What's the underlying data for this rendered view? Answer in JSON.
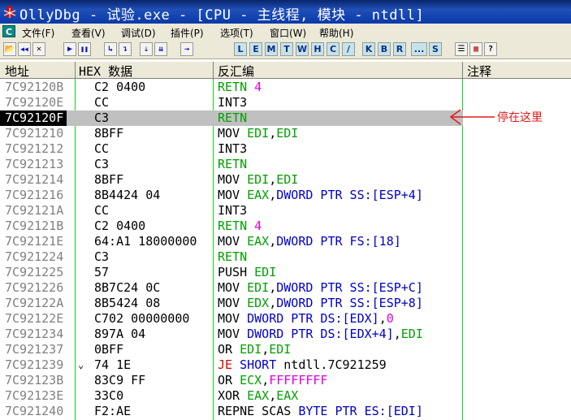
{
  "window": {
    "title": "OllyDbg - 试验.exe - [CPU - 主线程, 模块 - ntdll]"
  },
  "menu": [
    {
      "label": "文件(F)"
    },
    {
      "label": "查看(V)"
    },
    {
      "label": "调试(D)"
    },
    {
      "label": "插件(P)"
    },
    {
      "label": "选项(T)"
    },
    {
      "label": "窗口(W)"
    },
    {
      "label": "帮助(H)"
    }
  ],
  "menu_icon": "C",
  "toolbar": {
    "buttons": [
      {
        "name": "open-icon",
        "glyph": "📂"
      },
      {
        "name": "rewind-icon",
        "glyph": "◀◀"
      },
      {
        "name": "close-icon",
        "glyph": "✕"
      },
      {
        "name": "run-icon",
        "glyph": "▶"
      },
      {
        "name": "pause-icon",
        "glyph": "❚❚"
      },
      {
        "name": "step-into-icon",
        "glyph": "↳"
      },
      {
        "name": "step-over-icon",
        "glyph": "↴"
      },
      {
        "name": "trace-into-icon",
        "glyph": "⇣"
      },
      {
        "name": "trace-over-icon",
        "glyph": "⇊"
      },
      {
        "name": "execute-till-return-icon",
        "glyph": "→"
      }
    ],
    "letters": [
      "L",
      "E",
      "M",
      "T",
      "W",
      "H",
      "C",
      "/",
      "K",
      "B",
      "R",
      "...",
      "S"
    ],
    "right_buttons": [
      {
        "name": "list-icon",
        "glyph": "☰"
      },
      {
        "name": "grid-icon",
        "glyph": "▦"
      },
      {
        "name": "help-icon",
        "glyph": "?"
      }
    ]
  },
  "columns": {
    "address": "地址",
    "hex": "HEX 数据",
    "disasm": "反汇编",
    "comment": "注释"
  },
  "rows": [
    {
      "addr": "7C92120B",
      "hex": "C2 0400",
      "jm": "",
      "dis": [
        [
          "g",
          "RETN "
        ],
        [
          "m",
          "4"
        ]
      ]
    },
    {
      "addr": "7C92120E",
      "hex": "CC",
      "jm": "",
      "dis": [
        [
          "k",
          "INT3"
        ]
      ]
    },
    {
      "addr": "7C92120F",
      "hex": "C3",
      "jm": "",
      "sel": true,
      "dis": [
        [
          "g",
          "RETN"
        ]
      ]
    },
    {
      "addr": "7C921210",
      "hex": "8BFF",
      "jm": "",
      "dis": [
        [
          "k",
          "MOV "
        ],
        [
          "g",
          "EDI"
        ],
        [
          "k",
          ","
        ],
        [
          "g",
          "EDI"
        ]
      ]
    },
    {
      "addr": "7C921212",
      "hex": "CC",
      "jm": "",
      "dis": [
        [
          "k",
          "INT3"
        ]
      ]
    },
    {
      "addr": "7C921213",
      "hex": "C3",
      "jm": "",
      "dis": [
        [
          "g",
          "RETN"
        ]
      ]
    },
    {
      "addr": "7C921214",
      "hex": "8BFF",
      "jm": "",
      "dis": [
        [
          "k",
          "MOV "
        ],
        [
          "g",
          "EDI"
        ],
        [
          "k",
          ","
        ],
        [
          "g",
          "EDI"
        ]
      ]
    },
    {
      "addr": "7C921216",
      "hex": "8B4424 04",
      "jm": "",
      "dis": [
        [
          "k",
          "MOV "
        ],
        [
          "g",
          "EAX"
        ],
        [
          "k",
          ","
        ],
        [
          "b",
          "DWORD PTR SS:[ESP+4]"
        ]
      ]
    },
    {
      "addr": "7C92121A",
      "hex": "CC",
      "jm": "",
      "dis": [
        [
          "k",
          "INT3"
        ]
      ]
    },
    {
      "addr": "7C92121B",
      "hex": "C2 0400",
      "jm": "",
      "dis": [
        [
          "g",
          "RETN "
        ],
        [
          "m",
          "4"
        ]
      ]
    },
    {
      "addr": "7C92121E",
      "hex": "64:A1 18000000",
      "jm": "",
      "dis": [
        [
          "k",
          "MOV "
        ],
        [
          "g",
          "EAX"
        ],
        [
          "k",
          ","
        ],
        [
          "b",
          "DWORD PTR FS:[18]"
        ]
      ]
    },
    {
      "addr": "7C921224",
      "hex": "C3",
      "jm": "",
      "dis": [
        [
          "g",
          "RETN"
        ]
      ]
    },
    {
      "addr": "7C921225",
      "hex": "57",
      "jm": "",
      "dis": [
        [
          "k",
          "PUSH "
        ],
        [
          "g",
          "EDI"
        ]
      ]
    },
    {
      "addr": "7C921226",
      "hex": "8B7C24 0C",
      "jm": "",
      "dis": [
        [
          "k",
          "MOV "
        ],
        [
          "g",
          "EDI"
        ],
        [
          "k",
          ","
        ],
        [
          "b",
          "DWORD PTR SS:[ESP+C]"
        ]
      ]
    },
    {
      "addr": "7C92122A",
      "hex": "8B5424 08",
      "jm": "",
      "dis": [
        [
          "k",
          "MOV "
        ],
        [
          "g",
          "EDX"
        ],
        [
          "k",
          ","
        ],
        [
          "b",
          "DWORD PTR SS:[ESP+8]"
        ]
      ]
    },
    {
      "addr": "7C92122E",
      "hex": "C702 00000000",
      "jm": "",
      "dis": [
        [
          "k",
          "MOV "
        ],
        [
          "b",
          "DWORD PTR DS:[EDX]"
        ],
        [
          "k",
          ","
        ],
        [
          "m",
          "0"
        ]
      ]
    },
    {
      "addr": "7C921234",
      "hex": "897A 04",
      "jm": "",
      "dis": [
        [
          "k",
          "MOV "
        ],
        [
          "b",
          "DWORD PTR DS:[EDX+4]"
        ],
        [
          "k",
          ","
        ],
        [
          "g",
          "EDI"
        ]
      ]
    },
    {
      "addr": "7C921237",
      "hex": "0BFF",
      "jm": "",
      "dis": [
        [
          "k",
          "OR "
        ],
        [
          "g",
          "EDI"
        ],
        [
          "k",
          ","
        ],
        [
          "g",
          "EDI"
        ]
      ]
    },
    {
      "addr": "7C921239",
      "hex": "74 1E",
      "jm": "⌄",
      "dis": [
        [
          "r",
          "JE "
        ],
        [
          "b",
          "SHORT "
        ],
        [
          "k",
          "ntdll.7C921259"
        ]
      ]
    },
    {
      "addr": "7C92123B",
      "hex": "83C9 FF",
      "jm": "",
      "dis": [
        [
          "k",
          "OR "
        ],
        [
          "g",
          "ECX"
        ],
        [
          "k",
          ","
        ],
        [
          "m",
          "FFFFFFFF"
        ]
      ]
    },
    {
      "addr": "7C92123E",
      "hex": "33C0",
      "jm": "",
      "dis": [
        [
          "k",
          "XOR "
        ],
        [
          "g",
          "EAX"
        ],
        [
          "k",
          ","
        ],
        [
          "g",
          "EAX"
        ]
      ]
    },
    {
      "addr": "7C921240",
      "hex": "F2:AE",
      "jm": "",
      "dis": [
        [
          "k",
          "REPNE SCAS "
        ],
        [
          "b",
          "BYTE PTR ES:[EDI]"
        ]
      ]
    }
  ],
  "annotation": {
    "text": "停在这里"
  },
  "colors": {
    "accent_green": "#14d314",
    "annotation_red": "#e01818",
    "selected_row": "#c0c0c0"
  }
}
